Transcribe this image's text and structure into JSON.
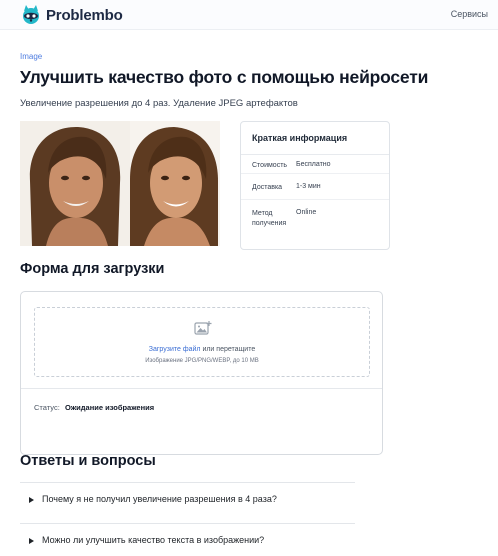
{
  "header": {
    "brand": "Problembo",
    "services_label": "Сервисы"
  },
  "page": {
    "category": "Image",
    "title": "Улучшить качество фото с помощью нейросети",
    "subtitle": "Увеличение разрешения до 4 раз. Удаление JPEG артефактов"
  },
  "info": {
    "title": "Краткая информация",
    "rows": [
      {
        "key": "Стоимость",
        "value": "Бесплатно"
      },
      {
        "key": "Доставка",
        "value": "1-3 мин"
      },
      {
        "key": "Метод получения",
        "value": "Online"
      }
    ]
  },
  "upload": {
    "heading": "Форма для загрузки",
    "link_text": "Загрузите файл",
    "or_text": "или перетащите",
    "hint": "Изображение JPG/PNG/WEBP, до 10 MB",
    "status_label": "Статус:",
    "status_value": "Ожидание изображения"
  },
  "faq": {
    "heading": "Ответы и вопросы",
    "items": [
      {
        "question": "Почему я не получил увеличение разрешения в 4 раза?"
      },
      {
        "question": "Можно ли улучшить качество текста в изображении?"
      }
    ]
  },
  "icons": {
    "logo": "raccoon-logo-icon",
    "upload": "image-upload-icon",
    "faq_toggle": "triangle-right-icon"
  },
  "colors": {
    "accent": "#3b6ed4",
    "brand_text": "#1e2a44",
    "logo_teal": "#23b8c9"
  }
}
